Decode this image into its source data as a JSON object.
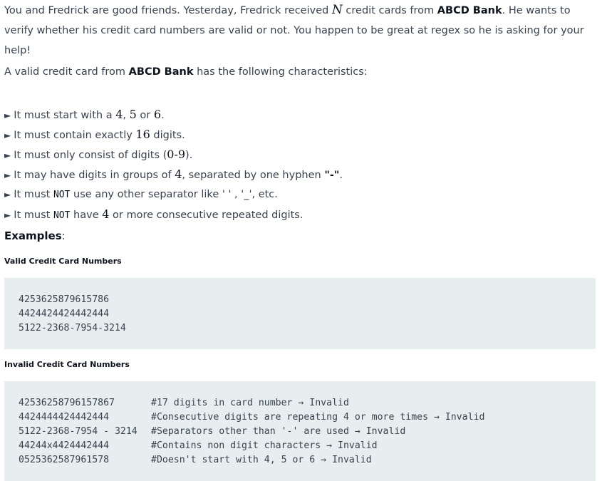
{
  "intro": {
    "part1": "You and Fredrick are good friends. Yesterday, Fredrick received ",
    "var_n": "N",
    "part2": " credit cards from ",
    "bank": "ABCD Bank",
    "part3": ". He wants to verify whether his credit card numbers are valid or not. You happen to be great at regex so he is asking for your help!"
  },
  "lead": {
    "part1": "A valid credit card from ",
    "bank": "ABCD Bank",
    "part2": " has the following characteristics:"
  },
  "rules": {
    "bullet": "►",
    "r1": {
      "a": "It must start with a ",
      "n1": "4",
      "sep1": ", ",
      "n2": "5",
      "sep2": " or ",
      "n3": "6",
      "end": "."
    },
    "r2": {
      "a": "It must contain exactly ",
      "n": "16",
      "b": " digits."
    },
    "r3": {
      "a": "It must only consist of digits (",
      "range": "0-9",
      "b": ")."
    },
    "r4": {
      "a": "It may have digits in groups of ",
      "n": "4",
      "b": ", separated by one hyphen ",
      "hyphen": "\"-\"",
      "c": "."
    },
    "r5": {
      "a": "It must ",
      "not": "NOT",
      "b": " use any other separator like ' ' , '_', etc."
    },
    "r6": {
      "a": "It must ",
      "not": "NOT",
      "b": " have ",
      "n": "4",
      "c": " or more consecutive repeated digits."
    }
  },
  "examples": {
    "heading": "Examples",
    "colon": ":",
    "valid_heading": "Valid Credit Card Numbers",
    "valid": [
      "4253625879615786",
      "4424424424442444",
      "5122-2368-7954-3214"
    ],
    "invalid_heading": "Invalid Credit Card Numbers",
    "invalid": [
      {
        "num": "42536258796157867",
        "comment": "#17 digits in card number → Invalid"
      },
      {
        "num": "4424444424442444",
        "comment": "#Consecutive digits are repeating 4 or more times → Invalid"
      },
      {
        "num": "5122-2368-7954 - 3214",
        "comment": "#Separators other than '-' are used → Invalid"
      },
      {
        "num": "44244x4424442444",
        "comment": "#Contains non digit characters → Invalid"
      },
      {
        "num": "0525362587961578",
        "comment": "#Doesn't start with 4, 5 or 6 → Invalid"
      }
    ]
  }
}
